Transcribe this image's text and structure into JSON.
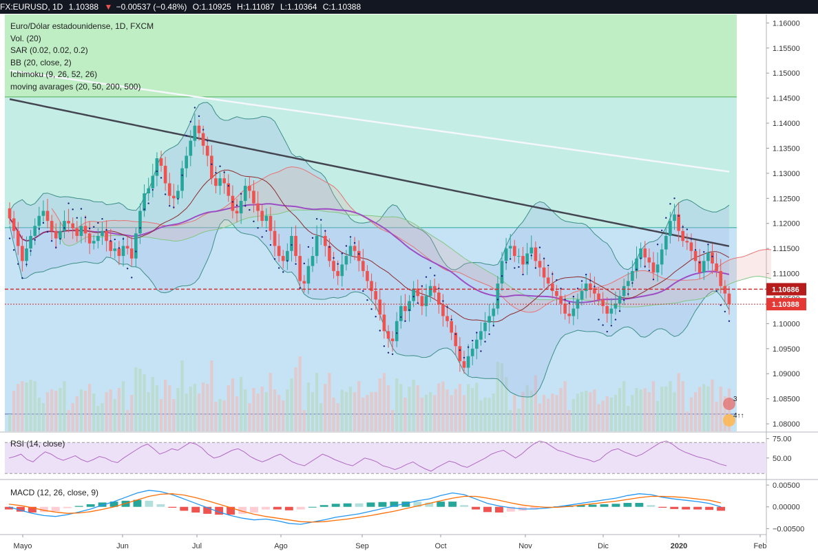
{
  "header": {
    "symbol": "FX:EURUSD, 1D",
    "last": "1.10388",
    "change": "−0.00537 (−0.48%)",
    "o_label": "O:",
    "o_value": "1.10925",
    "h_label": "H:",
    "h_value": "1.11087",
    "l_label": "L:",
    "l_value": "1.10364",
    "c_label": "C:",
    "c_value": "1.10388",
    "down_arrow": "▼"
  },
  "legend": {
    "title": "Euro/Dólar estadounidense, 1D, FXCM",
    "items": [
      "Vol. (20)",
      "SAR (0.02, 0.02, 0.2)",
      "BB (20, close, 2)",
      "Ichimoku (9, 26, 52, 26)",
      "moving avarages (20, 50, 200, 500)"
    ]
  },
  "rsi_title": "RSI (14, close)",
  "macd_title": "MACD (12, 26, close, 9)",
  "markers": {
    "earnings_count": "3",
    "flag_count": "4↑↑"
  },
  "colors": {
    "bull": "#26a69a",
    "bear": "#ef5350",
    "zone_green": "#bfeec5",
    "zone_teal": "#c4ede6",
    "zone_blue": "#c6e3f5",
    "ma200": "#434651",
    "ma500": "#f0f3fa",
    "ma50": "#9c4dc4",
    "ma20": "#8b2a2a",
    "bb": "#3b8e86",
    "rsi_line": "#b168c6",
    "rsi_band": "#ece1f6",
    "macd": "#2196f3",
    "signal": "#ff6d00",
    "price_label": "#e53935",
    "price_line": "#d32f2f"
  },
  "chart_data": [
    {
      "type": "candlestick",
      "title": "Euro/Dólar estadounidense, 1D, FXCM",
      "x_labels": [
        "Mayo",
        "Jun",
        "Jul",
        "Ago",
        "Sep",
        "Oct",
        "Nov",
        "Dic",
        "2020",
        "Feb"
      ],
      "y_ticks": [
        "1.16000",
        "1.15500",
        "1.15000",
        "1.14500",
        "1.14000",
        "1.13500",
        "1.13000",
        "1.12500",
        "1.12000",
        "1.11500",
        "1.11000",
        "1.10500",
        "1.10000",
        "1.09500",
        "1.09000",
        "1.08500",
        "1.08000"
      ],
      "ylim": [
        1.0785,
        1.1617
      ],
      "price_labels": [
        {
          "value": "1.10686",
          "level": 1.10686,
          "style": "dashed"
        },
        {
          "value": "1.10388",
          "level": 1.10388,
          "style": "dotted"
        }
      ],
      "horizontal_levels": [
        1.14525,
        1.11915,
        1.08195
      ],
      "candles_close": [
        1.121,
        1.1185,
        1.1155,
        1.1125,
        1.115,
        1.1175,
        1.1195,
        1.1215,
        1.1225,
        1.1205,
        1.1185,
        1.117,
        1.1185,
        1.1205,
        1.12,
        1.119,
        1.1175,
        1.1195,
        1.118,
        1.116,
        1.1165,
        1.1175,
        1.1185,
        1.1165,
        1.1145,
        1.115,
        1.1135,
        1.1155,
        1.115,
        1.113,
        1.118,
        1.1225,
        1.126,
        1.127,
        1.1295,
        1.133,
        1.1315,
        1.128,
        1.1255,
        1.125,
        1.1265,
        1.131,
        1.1335,
        1.1365,
        1.1395,
        1.138,
        1.1355,
        1.1335,
        1.129,
        1.1275,
        1.129,
        1.128,
        1.1255,
        1.1225,
        1.122,
        1.1245,
        1.1275,
        1.1265,
        1.124,
        1.1225,
        1.1205,
        1.1215,
        1.1185,
        1.1155,
        1.1135,
        1.1125,
        1.1145,
        1.1175,
        1.1135,
        1.1085,
        1.108,
        1.1115,
        1.1135,
        1.1175,
        1.1175,
        1.1155,
        1.1125,
        1.1105,
        1.1095,
        1.1118,
        1.1135,
        1.1155,
        1.1145,
        1.1125,
        1.1105,
        1.1085,
        1.1065,
        1.1048,
        1.1018,
        1.0985,
        1.097,
        1.0965,
        1.1005,
        1.1035,
        1.1025,
        1.1045,
        1.107,
        1.1055,
        1.1035,
        1.1055,
        1.1075,
        1.1062,
        1.1038,
        1.1015,
        1.1005,
        1.0982,
        1.0955,
        1.0925,
        1.0912,
        1.0935,
        1.095,
        1.0968,
        1.0985,
        1.1002,
        1.1015,
        1.103,
        1.108,
        1.1125,
        1.115,
        1.1155,
        1.1135,
        1.1135,
        1.1118,
        1.114,
        1.1152,
        1.1125,
        1.1112,
        1.1092,
        1.108,
        1.1065,
        1.1055,
        1.104,
        1.102,
        1.1015,
        1.103,
        1.1048,
        1.1065,
        1.108,
        1.107,
        1.106,
        1.1048,
        1.1035,
        1.102,
        1.103,
        1.104,
        1.1055,
        1.1075,
        1.1085,
        1.1105,
        1.113,
        1.115,
        1.1132,
        1.1122,
        1.1102,
        1.1118,
        1.1148,
        1.1175,
        1.1205,
        1.1218,
        1.1185,
        1.1165,
        1.1162,
        1.1145,
        1.1125,
        1.1102,
        1.1125,
        1.1142,
        1.112,
        1.1105,
        1.1075,
        1.106,
        1.1039
      ],
      "volume_note": "Vol. (20)"
    },
    {
      "type": "line",
      "title": "RSI (14, close)",
      "y_ticks": [
        "75.00",
        "50.00"
      ],
      "ylim": [
        24,
        80
      ],
      "bands": [
        70,
        30
      ],
      "values": [
        50,
        52,
        55,
        48,
        45,
        52,
        58,
        55,
        50,
        47,
        50,
        53,
        48,
        45,
        48,
        52,
        50,
        46,
        44,
        50,
        55,
        60,
        65,
        68,
        62,
        55,
        58,
        62,
        60,
        65,
        70,
        68,
        63,
        55,
        50,
        52,
        56,
        60,
        62,
        58,
        52,
        48,
        45,
        48,
        52,
        55,
        50,
        45,
        42,
        40,
        45,
        50,
        55,
        52,
        48,
        45,
        42,
        40,
        45,
        50,
        48,
        45,
        40,
        38,
        35,
        38,
        42,
        45,
        40,
        36,
        33,
        38,
        42,
        46,
        44,
        40,
        38,
        42,
        46,
        50,
        55,
        58,
        60,
        55,
        50,
        55,
        62,
        68,
        72,
        70,
        65,
        60,
        58,
        55,
        52,
        50,
        48,
        45,
        48,
        55,
        60,
        62,
        58,
        55,
        52,
        55,
        60,
        65,
        70,
        72,
        68,
        62,
        58,
        55,
        52,
        50,
        48,
        45,
        42,
        40
      ]
    },
    {
      "type": "bar+line",
      "title": "MACD (12, 26, close, 9)",
      "y_ticks": [
        "0.00500",
        "0.00000",
        "−0.00500"
      ],
      "ylim": [
        -0.0062,
        0.0058
      ],
      "series": [
        {
          "name": "MACD",
          "values": [
            0.0,
            -0.0008,
            -0.0015,
            -0.002,
            -0.0022,
            -0.0018,
            -0.0012,
            -0.0005,
            0.0004,
            0.0012,
            0.0022,
            0.0032,
            0.0038,
            0.0035,
            0.0028,
            0.0018,
            0.0008,
            -0.0002,
            -0.0012,
            -0.002,
            -0.0026,
            -0.003,
            -0.0028,
            -0.0032,
            -0.0038,
            -0.004,
            -0.0035,
            -0.003,
            -0.0024,
            -0.002,
            -0.0016,
            -0.001,
            -0.0004,
            0.0002,
            0.0008,
            0.0014,
            0.0018,
            0.0026,
            0.0032,
            0.0028,
            0.0018,
            0.0008,
            0.0002,
            -0.0002,
            -0.0005,
            -0.0005,
            -0.0003,
            0.0,
            0.0004,
            0.0008,
            0.0012,
            0.0016,
            0.002,
            0.0026,
            0.003,
            0.0028,
            0.0022,
            0.0018,
            0.0015,
            0.0012,
            0.0008,
            0.0
          ]
        },
        {
          "name": "Signal",
          "values": [
            0.0006,
            0.0003,
            -0.0002,
            -0.0008,
            -0.0012,
            -0.0015,
            -0.0014,
            -0.0011,
            -0.0006,
            0.0,
            0.0008,
            0.0016,
            0.0024,
            0.0029,
            0.003,
            0.0027,
            0.0021,
            0.0014,
            0.0006,
            -0.0002,
            -0.001,
            -0.0017,
            -0.0022,
            -0.0026,
            -0.003,
            -0.0034,
            -0.0035,
            -0.0034,
            -0.0031,
            -0.0028,
            -0.0024,
            -0.002,
            -0.0015,
            -0.001,
            -0.0004,
            0.0002,
            0.0008,
            0.0014,
            0.002,
            0.0024,
            0.0024,
            0.002,
            0.0015,
            0.0009,
            0.0004,
            0.0001,
            -0.0001,
            -0.0001,
            0.0001,
            0.0004,
            0.0007,
            0.001,
            0.0013,
            0.0017,
            0.0021,
            0.0024,
            0.0024,
            0.0023,
            0.0021,
            0.0018,
            0.0015,
            0.0009
          ]
        }
      ]
    }
  ]
}
